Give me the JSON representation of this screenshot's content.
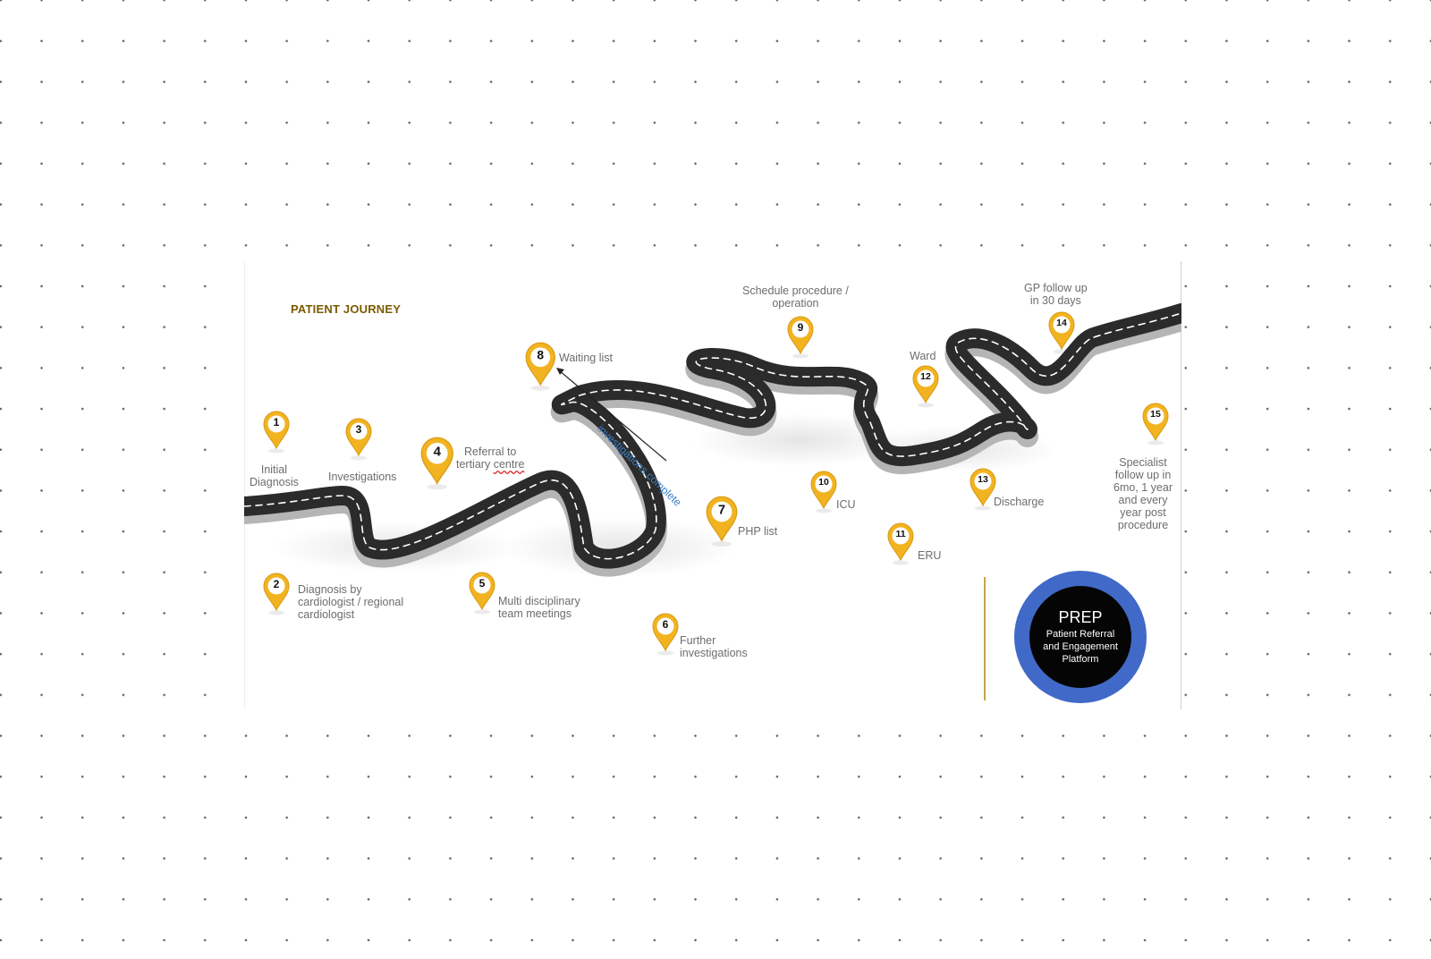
{
  "title": "PATIENT JOURNEY",
  "road_note": "investigations complete",
  "stops": [
    {
      "number": "1",
      "label": "Initial\nDiagnosis"
    },
    {
      "number": "2",
      "label": "Diagnosis by\ncardiologist / regional\ncardiologist"
    },
    {
      "number": "3",
      "label": "Investigations"
    },
    {
      "number": "4",
      "label_line1": "Referral to",
      "label_line2_a": "tertiary ",
      "label_line2_b": "centre"
    },
    {
      "number": "5",
      "label": "Multi disciplinary\nteam meetings"
    },
    {
      "number": "6",
      "label": "Further\ninvestigations"
    },
    {
      "number": "7",
      "label": "PHP list"
    },
    {
      "number": "8",
      "label": "Waiting list"
    },
    {
      "number": "9",
      "label": "Schedule procedure /\noperation"
    },
    {
      "number": "10",
      "label": "ICU"
    },
    {
      "number": "11",
      "label": "ERU"
    },
    {
      "number": "12",
      "label": "Ward"
    },
    {
      "number": "13",
      "label": "Discharge"
    },
    {
      "number": "14",
      "label": "GP follow up\nin 30 days"
    },
    {
      "number": "15",
      "label": "Specialist\nfollow up in\n6mo, 1 year\nand every\nyear post\nprocedure"
    }
  ],
  "logo": {
    "name": "PREP",
    "full_name": "Patient Referral\nand Engagement\nPlatform"
  },
  "colors": {
    "pin": "#f2b321",
    "pin_dark": "#d99a10",
    "road": "#2b2b2b",
    "road_side": "#b5b5b5",
    "title": "#7a5a00",
    "note": "#3b7fc4",
    "logo_ring": "#4169c8"
  }
}
